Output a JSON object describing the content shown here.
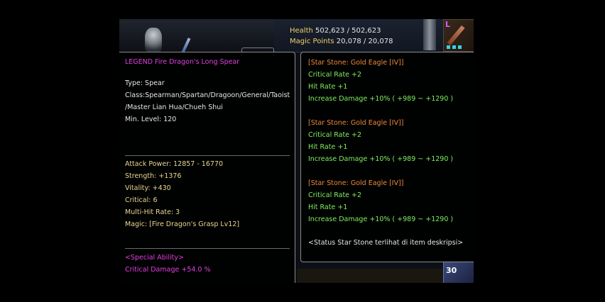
{
  "hud": {
    "health_label": "Health",
    "health_value": "502,623 / 502,623",
    "mp_label": "Magic Points",
    "mp_value": "20,078 / 20,078"
  },
  "quick_slot": {
    "tag": "L",
    "icon": "spear-icon"
  },
  "bottom_slot": {
    "count": "30",
    "icon": "item-icon"
  },
  "item": {
    "name": "LEGEND Fire Dragon's Long Spear",
    "type": "Type: Spear",
    "class_line1": "Class:Spearman/Spartan/Dragoon/General/Taoist",
    "class_line2": "/Master Lian Hua/Chueh Shui",
    "min_level": "Min. Level: 120",
    "stats": [
      "Attack Power: 12857 - 16770",
      "Strength: +1376",
      "Vitality: +430",
      "Critical: 6",
      "Multi-Hit Rate: 3",
      "Magic: [Fire Dragon's Grasp Lv12]"
    ],
    "special_header": "<Special Ability>",
    "special_value": "Critical Damage +54.0 %"
  },
  "star_stones": [
    {
      "name": "[Star Stone: Gold Eagle [IV]]",
      "crit": "Critical Rate +2",
      "hit": "Hit Rate +1",
      "dmg": "Increase Damage +10% ( +989 ~ +1290 )"
    },
    {
      "name": "[Star Stone: Gold Eagle [IV]]",
      "crit": "Critical Rate +2",
      "hit": "Hit Rate +1",
      "dmg": "Increase Damage +10% ( +989 ~ +1290 )"
    },
    {
      "name": "[Star Stone: Gold Eagle [IV]]",
      "crit": "Critical Rate +2",
      "hit": "Hit Rate +1",
      "dmg": "Increase Damage +10% ( +989 ~ +1290 )"
    }
  ],
  "status_note": "<Status Star Stone terlihat di item deskripsi>",
  "colors": {
    "name": "#e040e0",
    "stat": "#e8d890",
    "stone_name": "#f08a3a",
    "stone_stat": "#80f060",
    "special": "#e040e0"
  }
}
